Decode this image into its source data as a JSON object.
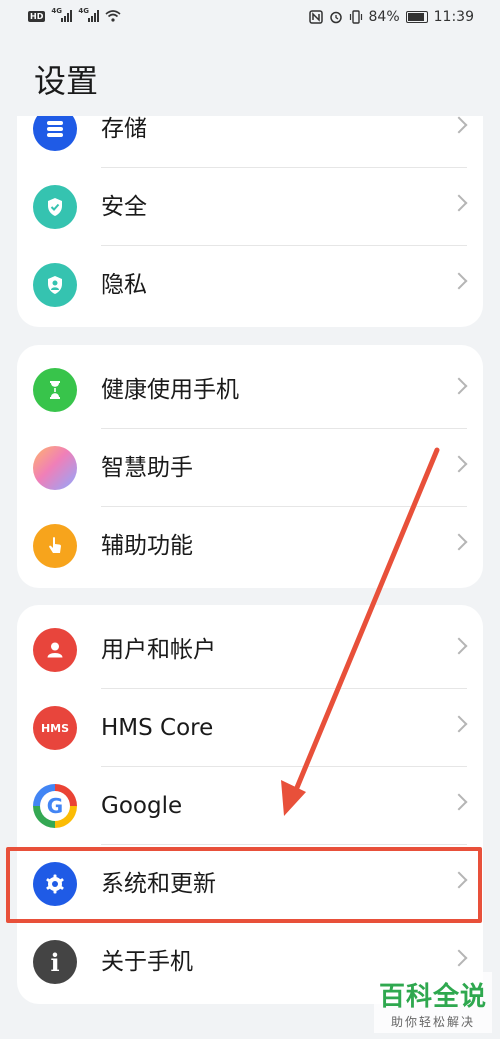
{
  "status_bar": {
    "left_badge": "HD",
    "signal_label_1": "4G",
    "signal_label_2": "4G",
    "battery": "84%",
    "time": "11:39"
  },
  "page_title": "设置",
  "groups": [
    {
      "items": [
        {
          "label": "存储",
          "icon": "storage-icon",
          "color": "#1f5be6"
        },
        {
          "label": "安全",
          "icon": "security-shield-icon",
          "color": "#35c3b0"
        },
        {
          "label": "隐私",
          "icon": "privacy-icon",
          "color": "#35c3b0"
        }
      ]
    },
    {
      "items": [
        {
          "label": "健康使用手机",
          "icon": "hourglass-icon",
          "color": "#38c44b"
        },
        {
          "label": "智慧助手",
          "icon": "smart-assistant-icon",
          "color": "#b88af2"
        },
        {
          "label": "辅助功能",
          "icon": "accessibility-hand-icon",
          "color": "#f7a41c"
        }
      ]
    },
    {
      "items": [
        {
          "label": "用户和帐户",
          "icon": "user-icon",
          "color": "#e8453c"
        },
        {
          "label": "HMS Core",
          "icon": "hms-icon",
          "color": "#e8453c",
          "icon_text": "HMS"
        },
        {
          "label": "Google",
          "icon": "google-icon",
          "color": "#ffffff",
          "icon_text": "G"
        },
        {
          "label": "系统和更新",
          "icon": "gear-icon",
          "color": "#1f5be6"
        },
        {
          "label": "关于手机",
          "icon": "info-icon",
          "color": "#444444",
          "icon_text": "i"
        }
      ]
    }
  ],
  "watermark": {
    "main": "百科全说",
    "sub": "助你轻松解决"
  },
  "colors": {
    "annotation": "#e8503a",
    "background": "#f1f3f5"
  }
}
